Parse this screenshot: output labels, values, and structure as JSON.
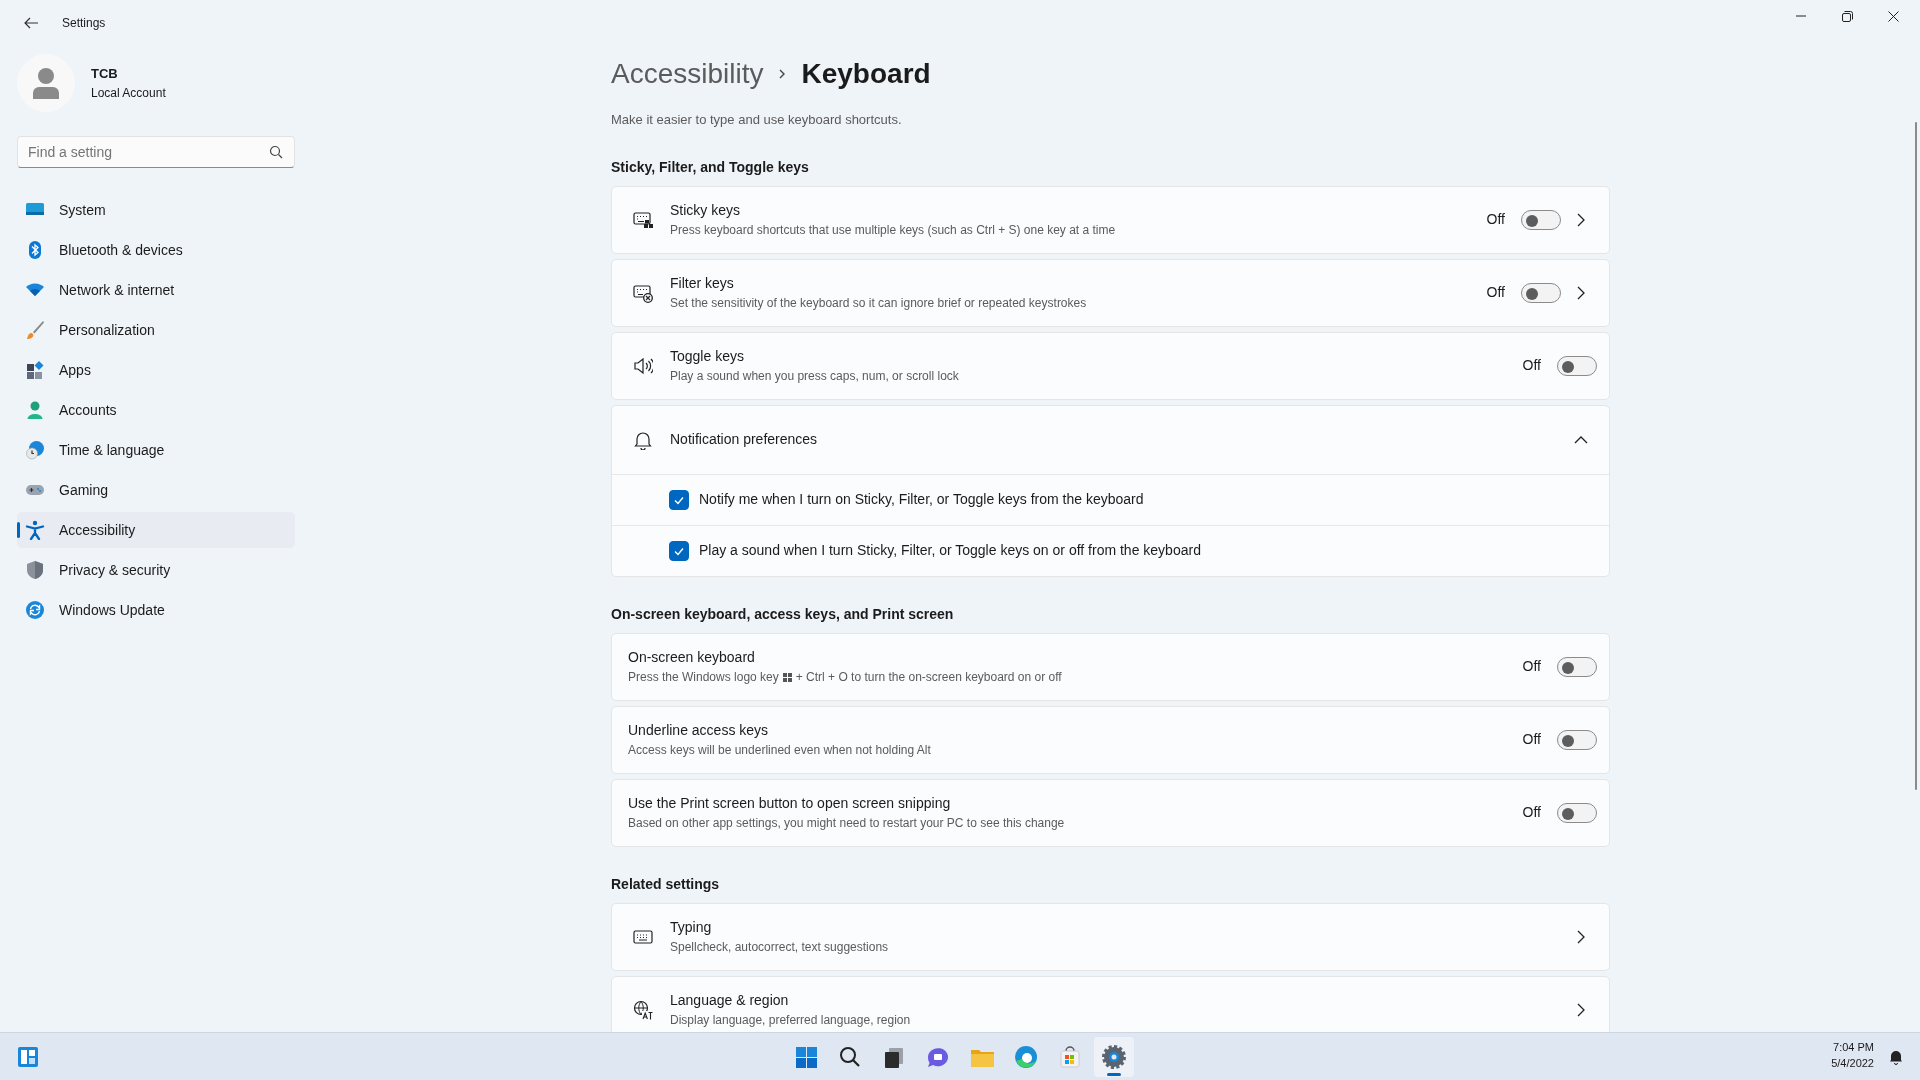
{
  "window": {
    "title": "Settings"
  },
  "account": {
    "name": "TCB",
    "type": "Local Account"
  },
  "search": {
    "placeholder": "Find a setting"
  },
  "nav": [
    {
      "label": "System",
      "selected": false
    },
    {
      "label": "Bluetooth & devices",
      "selected": false
    },
    {
      "label": "Network & internet",
      "selected": false
    },
    {
      "label": "Personalization",
      "selected": false
    },
    {
      "label": "Apps",
      "selected": false
    },
    {
      "label": "Accounts",
      "selected": false
    },
    {
      "label": "Time & language",
      "selected": false
    },
    {
      "label": "Gaming",
      "selected": false
    },
    {
      "label": "Accessibility",
      "selected": true
    },
    {
      "label": "Privacy & security",
      "selected": false
    },
    {
      "label": "Windows Update",
      "selected": false
    }
  ],
  "breadcrumb": [
    "Accessibility",
    "Keyboard"
  ],
  "description": "Make it easier to type and use keyboard shortcuts.",
  "sections": [
    {
      "heading": "Sticky, Filter, and Toggle keys",
      "items": [
        {
          "kind": "toggle",
          "title": "Sticky keys",
          "subtitle": "Press keyboard shortcuts that use multiple keys (such as Ctrl + S) one key at a time",
          "state_label": "Off",
          "on": false,
          "chevron": true
        },
        {
          "kind": "toggle",
          "title": "Filter keys",
          "subtitle": "Set the sensitivity of the keyboard so it can ignore brief or repeated keystrokes",
          "state_label": "Off",
          "on": false,
          "chevron": true
        },
        {
          "kind": "toggle",
          "title": "Toggle keys",
          "subtitle": "Play a sound when you press caps, num, or scroll lock",
          "state_label": "Off",
          "on": false,
          "chevron": false
        },
        {
          "kind": "expander",
          "title": "Notification preferences",
          "expanded": true,
          "options": [
            {
              "label": "Notify me when I turn on Sticky, Filter, or Toggle keys from the keyboard",
              "checked": true
            },
            {
              "label": "Play a sound when I turn Sticky, Filter, or Toggle keys on or off from the keyboard",
              "checked": true
            }
          ]
        }
      ]
    },
    {
      "heading": "On-screen keyboard, access keys, and Print screen",
      "items": [
        {
          "kind": "toggle",
          "title": "On-screen keyboard",
          "subtitle": "Press the Windows logo key",
          "subtitle_end": "+ Ctrl + O to turn the on-screen keyboard on or off",
          "state_label": "Off",
          "on": false,
          "chevron": false
        },
        {
          "kind": "toggle",
          "title": "Underline access keys",
          "subtitle": "Access keys will be underlined even when not holding Alt",
          "state_label": "Off",
          "on": false,
          "chevron": false
        },
        {
          "kind": "toggle",
          "title": "Use the Print screen button to open screen snipping",
          "subtitle": "Based on other app settings, you might need to restart your PC to see this change",
          "state_label": "Off",
          "on": false,
          "chevron": false
        }
      ]
    },
    {
      "heading": "Related settings",
      "items": [
        {
          "kind": "link",
          "title": "Typing",
          "subtitle": "Spellcheck, autocorrect, text suggestions",
          "chevron": true
        },
        {
          "kind": "link",
          "title": "Language & region",
          "subtitle": "Display language, preferred language, region",
          "chevron": true
        }
      ]
    }
  ],
  "taskbar": {
    "apps": [
      {
        "selected": false
      },
      {
        "selected": false
      },
      {
        "selected": false
      },
      {
        "selected": false
      },
      {
        "selected": false
      },
      {
        "selected": false
      },
      {
        "selected": false
      },
      {
        "selected": true
      }
    ],
    "time": "7:04 PM",
    "date": "5/4/2022"
  }
}
